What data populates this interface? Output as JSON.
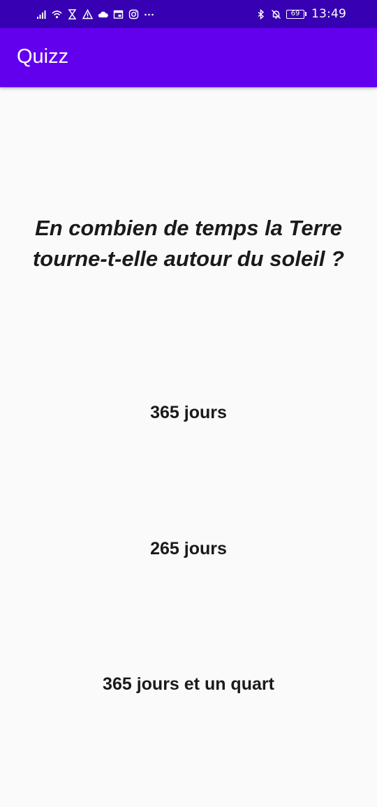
{
  "status_bar": {
    "time": "13:49",
    "battery_level": "69",
    "left_icons": [
      "signal-icon",
      "wifi-icon",
      "hourglass-icon",
      "warning-icon",
      "cloud-icon",
      "calendar-icon",
      "instagram-icon",
      "more-icon"
    ],
    "right_icons": [
      "bluetooth-icon",
      "notifications-off-icon",
      "battery-icon"
    ]
  },
  "app_bar": {
    "title": "Quizz",
    "color": "#6200ee",
    "status_color": "#3700b3"
  },
  "quiz": {
    "question": "En combien de temps la Terre tourne-t-elle autour du soleil ?",
    "answers": [
      {
        "label": "365 jours"
      },
      {
        "label": "265 jours"
      },
      {
        "label": "365 jours et un quart"
      }
    ]
  }
}
